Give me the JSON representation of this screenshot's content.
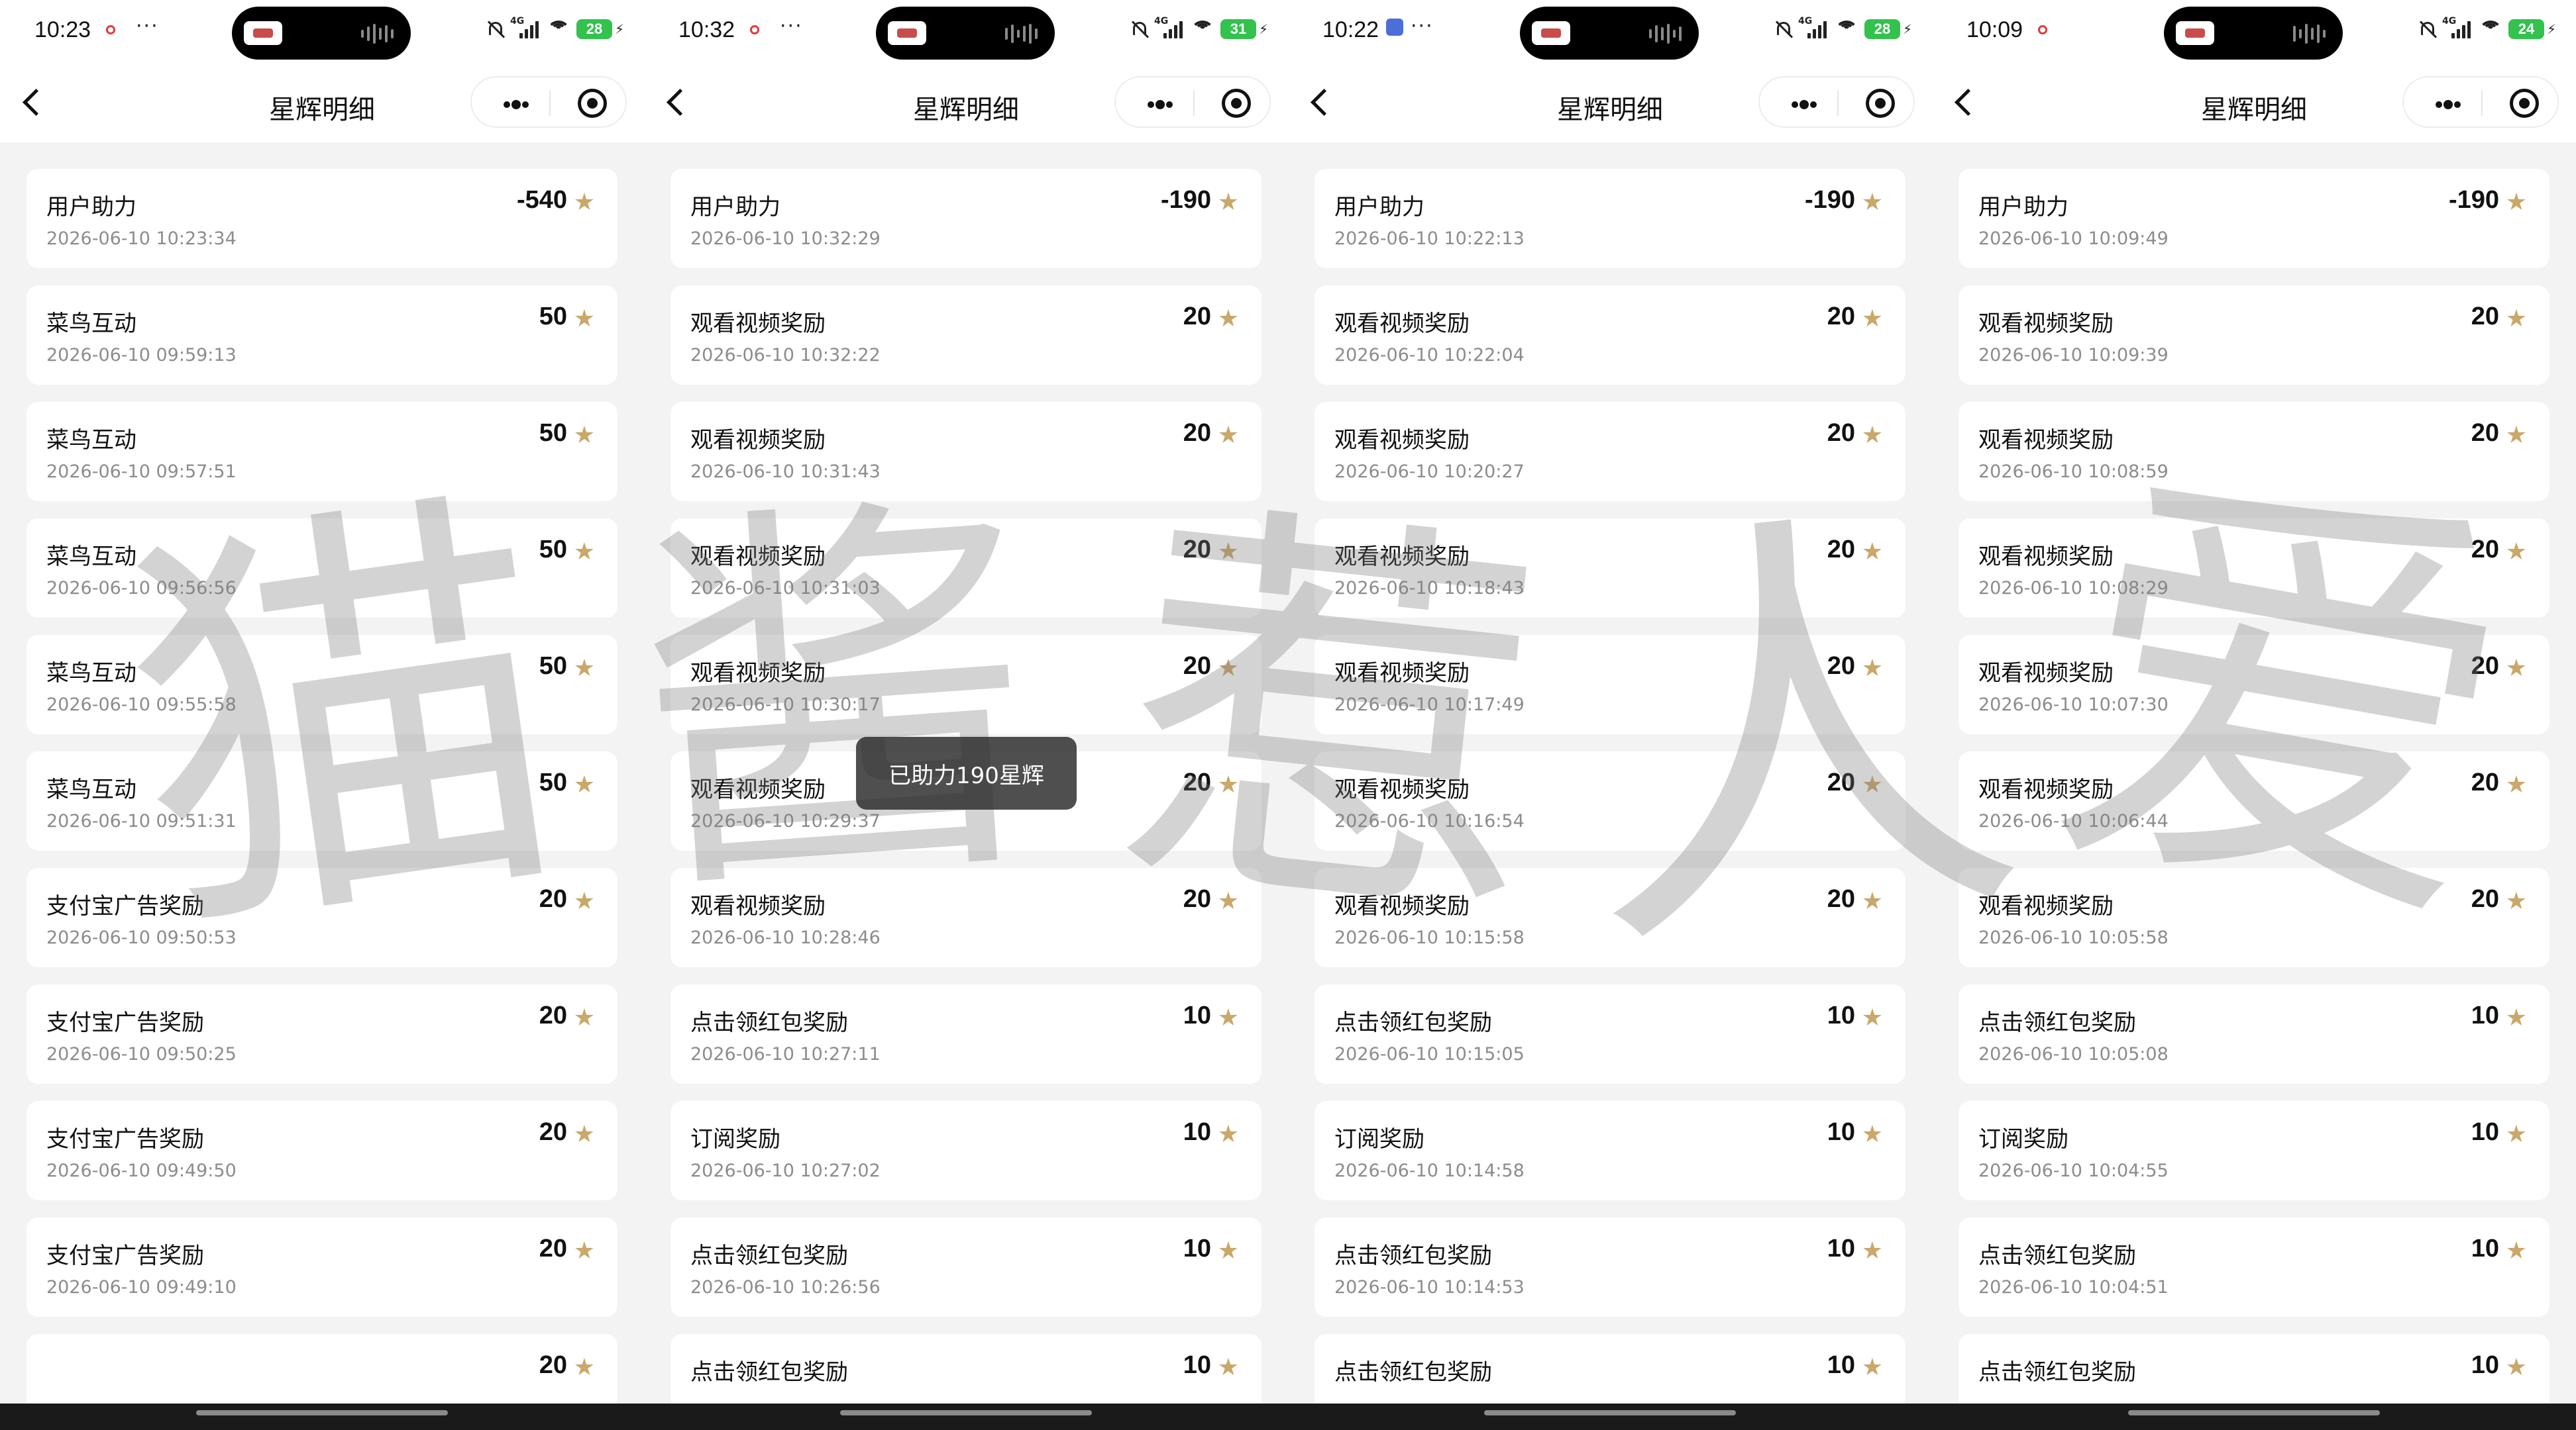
{
  "watermark": {
    "chars": [
      "猫",
      "酱",
      "惹",
      "人",
      "爱"
    ]
  },
  "toast": "已助力190星辉",
  "phones": [
    {
      "status": {
        "time": "10:23",
        "battery": "28",
        "network": "4G"
      },
      "title": "星辉明细",
      "rows": [
        {
          "title": "用户助力",
          "time": "2026-06-10 10:23:34",
          "amount": "-540"
        },
        {
          "title": "菜鸟互动",
          "time": "2026-06-10 09:59:13",
          "amount": "50"
        },
        {
          "title": "菜鸟互动",
          "time": "2026-06-10 09:57:51",
          "amount": "50"
        },
        {
          "title": "菜鸟互动",
          "time": "2026-06-10 09:56:56",
          "amount": "50"
        },
        {
          "title": "菜鸟互动",
          "time": "2026-06-10 09:55:58",
          "amount": "50"
        },
        {
          "title": "菜鸟互动",
          "time": "2026-06-10 09:51:31",
          "amount": "50"
        },
        {
          "title": "支付宝广告奖励",
          "time": "2026-06-10 09:50:53",
          "amount": "20"
        },
        {
          "title": "支付宝广告奖励",
          "time": "2026-06-10 09:50:25",
          "amount": "20"
        },
        {
          "title": "支付宝广告奖励",
          "time": "2026-06-10 09:49:50",
          "amount": "20"
        },
        {
          "title": "支付宝广告奖励",
          "time": "2026-06-10 09:49:10",
          "amount": "20"
        },
        {
          "title": "",
          "time": "",
          "amount": "20"
        }
      ]
    },
    {
      "status": {
        "time": "10:32",
        "battery": "31",
        "network": "4G"
      },
      "title": "星辉明细",
      "rows": [
        {
          "title": "用户助力",
          "time": "2026-06-10 10:32:29",
          "amount": "-190"
        },
        {
          "title": "观看视频奖励",
          "time": "2026-06-10 10:32:22",
          "amount": "20"
        },
        {
          "title": "观看视频奖励",
          "time": "2026-06-10 10:31:43",
          "amount": "20"
        },
        {
          "title": "观看视频奖励",
          "time": "2026-06-10 10:31:03",
          "amount": "20"
        },
        {
          "title": "观看视频奖励",
          "time": "2026-06-10 10:30:17",
          "amount": "20"
        },
        {
          "title": "观看视频奖励",
          "time": "2026-06-10 10:29:37",
          "amount": "20"
        },
        {
          "title": "观看视频奖励",
          "time": "2026-06-10 10:28:46",
          "amount": "20"
        },
        {
          "title": "点击领红包奖励",
          "time": "2026-06-10 10:27:11",
          "amount": "10"
        },
        {
          "title": "订阅奖励",
          "time": "2026-06-10 10:27:02",
          "amount": "10"
        },
        {
          "title": "点击领红包奖励",
          "time": "2026-06-10 10:26:56",
          "amount": "10"
        },
        {
          "title": "点击领红包奖励",
          "time": "",
          "amount": "10"
        }
      ]
    },
    {
      "status": {
        "time": "10:22",
        "battery": "28",
        "network": "4G"
      },
      "title": "星辉明细",
      "rows": [
        {
          "title": "用户助力",
          "time": "2026-06-10 10:22:13",
          "amount": "-190"
        },
        {
          "title": "观看视频奖励",
          "time": "2026-06-10 10:22:04",
          "amount": "20"
        },
        {
          "title": "观看视频奖励",
          "time": "2026-06-10 10:20:27",
          "amount": "20"
        },
        {
          "title": "观看视频奖励",
          "time": "2026-06-10 10:18:43",
          "amount": "20"
        },
        {
          "title": "观看视频奖励",
          "time": "2026-06-10 10:17:49",
          "amount": "20"
        },
        {
          "title": "观看视频奖励",
          "time": "2026-06-10 10:16:54",
          "amount": "20"
        },
        {
          "title": "观看视频奖励",
          "time": "2026-06-10 10:15:58",
          "amount": "20"
        },
        {
          "title": "点击领红包奖励",
          "time": "2026-06-10 10:15:05",
          "amount": "10"
        },
        {
          "title": "订阅奖励",
          "time": "2026-06-10 10:14:58",
          "amount": "10"
        },
        {
          "title": "点击领红包奖励",
          "time": "2026-06-10 10:14:53",
          "amount": "10"
        },
        {
          "title": "点击领红包奖励",
          "time": "",
          "amount": "10"
        }
      ]
    },
    {
      "status": {
        "time": "10:09",
        "battery": "24",
        "network": "4G"
      },
      "title": "星辉明细",
      "rows": [
        {
          "title": "用户助力",
          "time": "2026-06-10 10:09:49",
          "amount": "-190"
        },
        {
          "title": "观看视频奖励",
          "time": "2026-06-10 10:09:39",
          "amount": "20"
        },
        {
          "title": "观看视频奖励",
          "time": "2026-06-10 10:08:59",
          "amount": "20"
        },
        {
          "title": "观看视频奖励",
          "time": "2026-06-10 10:08:29",
          "amount": "20"
        },
        {
          "title": "观看视频奖励",
          "time": "2026-06-10 10:07:30",
          "amount": "20"
        },
        {
          "title": "观看视频奖励",
          "time": "2026-06-10 10:06:44",
          "amount": "20"
        },
        {
          "title": "观看视频奖励",
          "time": "2026-06-10 10:05:58",
          "amount": "20"
        },
        {
          "title": "点击领红包奖励",
          "time": "2026-06-10 10:05:08",
          "amount": "10"
        },
        {
          "title": "订阅奖励",
          "time": "2026-06-10 10:04:55",
          "amount": "10"
        },
        {
          "title": "点击领红包奖励",
          "time": "2026-06-10 10:04:51",
          "amount": "10"
        },
        {
          "title": "点击领红包奖励",
          "time": "",
          "amount": "10"
        }
      ]
    }
  ]
}
